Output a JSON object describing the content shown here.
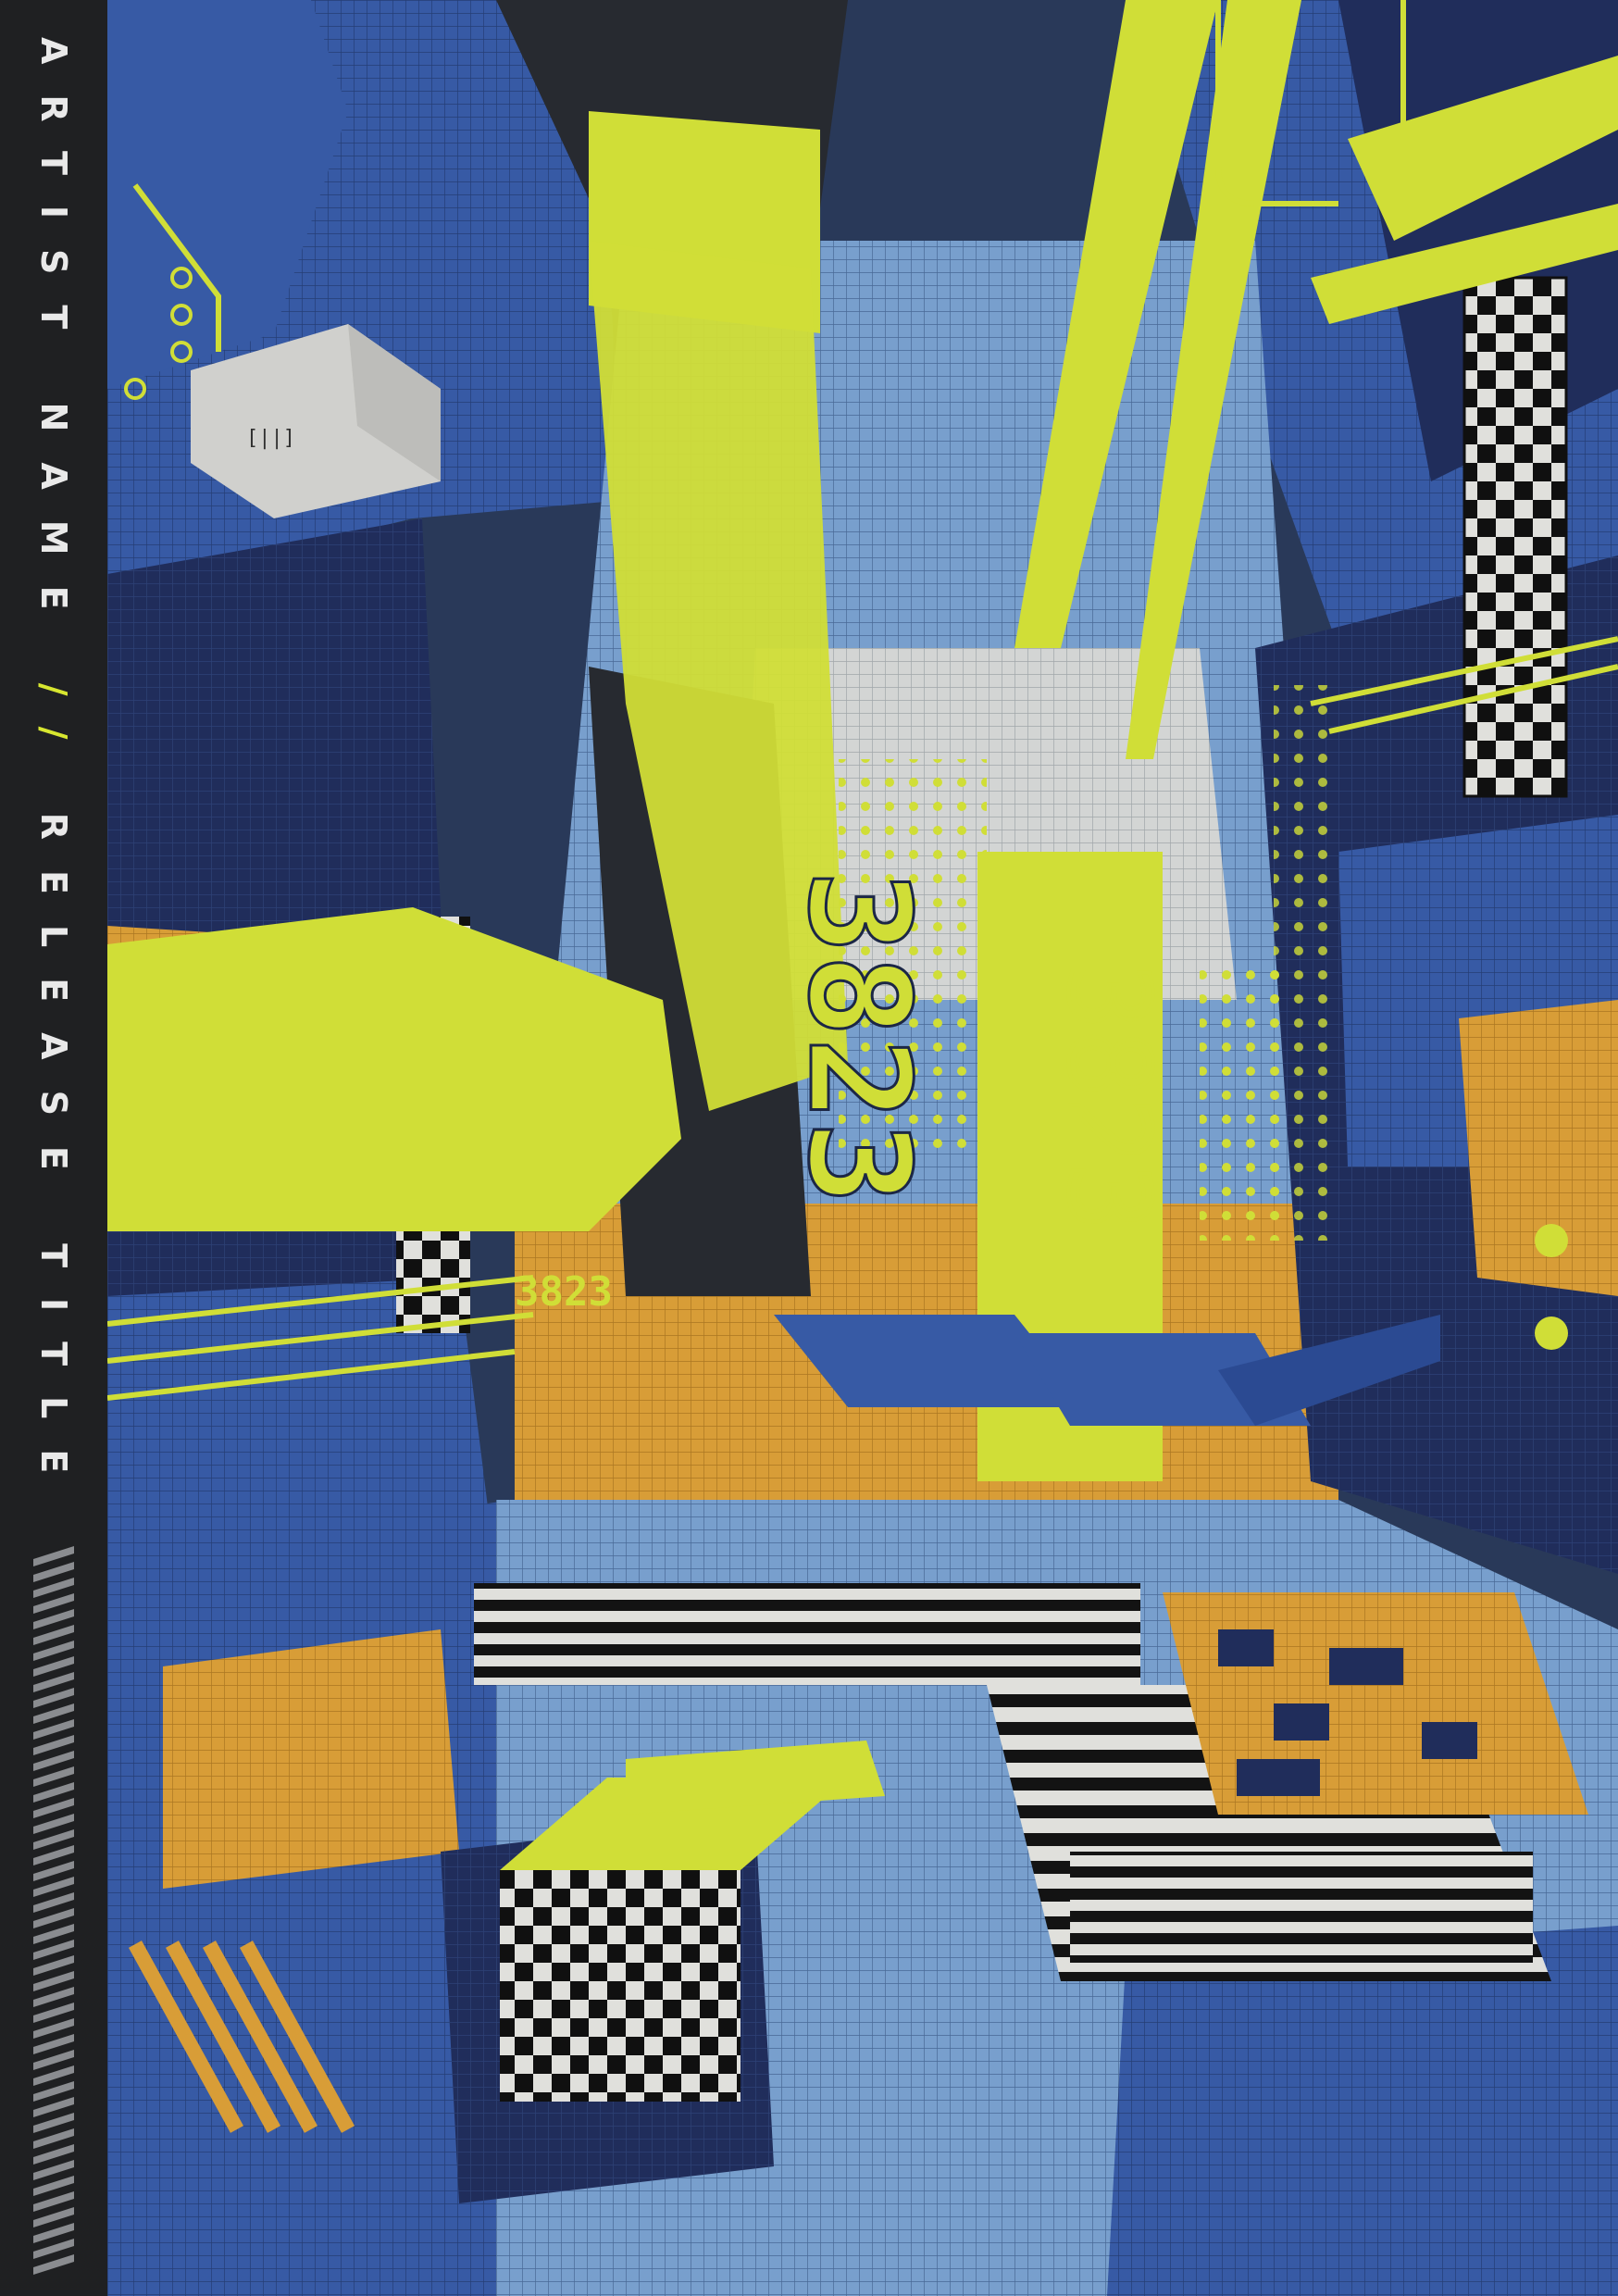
{
  "sidebar": {
    "artist": "ARTIST NAME",
    "separator": "//",
    "release": "RELEASE TITLE"
  },
  "artwork": {
    "labels": [
      "3823",
      "3823",
      "3823"
    ],
    "palette": {
      "yellow": "#dcea3a",
      "orange": "#e4a63a",
      "navy": "#223060",
      "blue": "#3a5fae",
      "light_blue": "#7fa8d8",
      "charcoal": "#2a2d33",
      "white": "#e8e8e4"
    }
  }
}
